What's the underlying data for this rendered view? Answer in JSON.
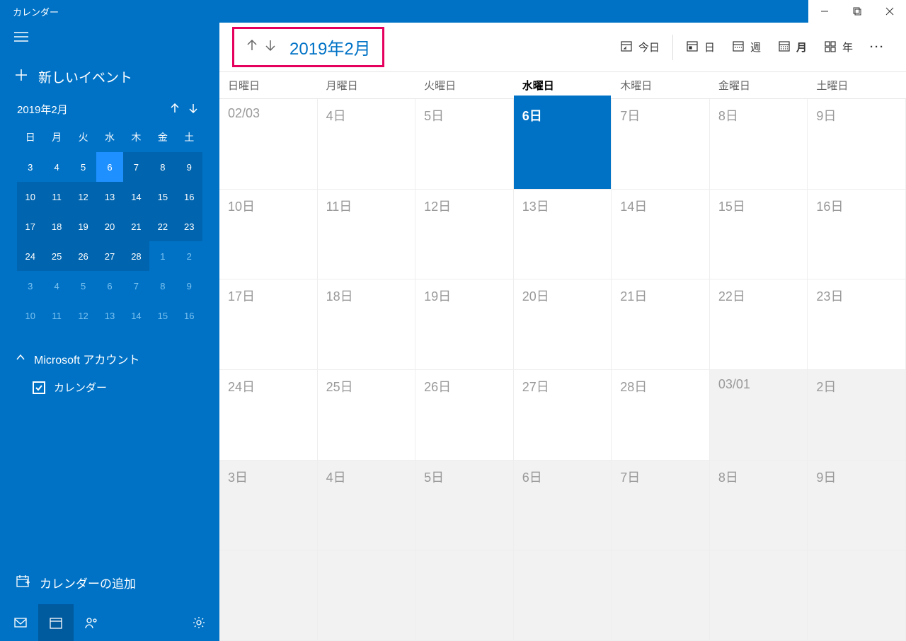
{
  "titlebar": {
    "title": "カレンダー"
  },
  "sidebar": {
    "new_event": "新しいイベント",
    "mini_cal": {
      "title": "2019年2月",
      "dow": [
        "日",
        "月",
        "火",
        "水",
        "木",
        "金",
        "土"
      ],
      "weeks": [
        [
          {
            "d": "3"
          },
          {
            "d": "4"
          },
          {
            "d": "5"
          },
          {
            "d": "6",
            "today": true
          },
          {
            "d": "7",
            "block": true
          },
          {
            "d": "8",
            "block": true
          },
          {
            "d": "9",
            "block": true
          }
        ],
        [
          {
            "d": "10",
            "block": true
          },
          {
            "d": "11",
            "block": true
          },
          {
            "d": "12",
            "block": true
          },
          {
            "d": "13",
            "block": true
          },
          {
            "d": "14",
            "block": true
          },
          {
            "d": "15",
            "block": true
          },
          {
            "d": "16",
            "block": true
          }
        ],
        [
          {
            "d": "17",
            "block": true
          },
          {
            "d": "18",
            "block": true
          },
          {
            "d": "19",
            "block": true
          },
          {
            "d": "20",
            "block": true
          },
          {
            "d": "21",
            "block": true
          },
          {
            "d": "22",
            "block": true
          },
          {
            "d": "23",
            "block": true
          }
        ],
        [
          {
            "d": "24",
            "block": true
          },
          {
            "d": "25",
            "block": true
          },
          {
            "d": "26",
            "block": true
          },
          {
            "d": "27",
            "block": true
          },
          {
            "d": "28",
            "block": true
          },
          {
            "d": "1",
            "nextmonth": true
          },
          {
            "d": "2",
            "nextmonth": true
          }
        ],
        [
          {
            "d": "3",
            "nextmonth": true
          },
          {
            "d": "4",
            "nextmonth": true
          },
          {
            "d": "5",
            "nextmonth": true
          },
          {
            "d": "6",
            "nextmonth": true
          },
          {
            "d": "7",
            "nextmonth": true
          },
          {
            "d": "8",
            "nextmonth": true
          },
          {
            "d": "9",
            "nextmonth": true
          }
        ],
        [
          {
            "d": "10",
            "nextmonth": true
          },
          {
            "d": "11",
            "nextmonth": true
          },
          {
            "d": "12",
            "nextmonth": true
          },
          {
            "d": "13",
            "nextmonth": true
          },
          {
            "d": "14",
            "nextmonth": true
          },
          {
            "d": "15",
            "nextmonth": true
          },
          {
            "d": "16",
            "nextmonth": true
          }
        ]
      ]
    },
    "account_header": "Microsoft アカウント",
    "account_item": "カレンダー",
    "add_calendar": "カレンダーの追加"
  },
  "toolbar": {
    "month_title": "2019年2月",
    "today": "今日",
    "views": {
      "day": "日",
      "week": "週",
      "month": "月",
      "year": "年"
    }
  },
  "dow": [
    {
      "label": "日曜日"
    },
    {
      "label": "月曜日"
    },
    {
      "label": "火曜日"
    },
    {
      "label": "水曜日",
      "today_col": true
    },
    {
      "label": "木曜日"
    },
    {
      "label": "金曜日"
    },
    {
      "label": "土曜日"
    }
  ],
  "grid": [
    [
      {
        "d": "02/03"
      },
      {
        "d": "4日"
      },
      {
        "d": "5日"
      },
      {
        "d": "6日",
        "today": true
      },
      {
        "d": "7日"
      },
      {
        "d": "8日"
      },
      {
        "d": "9日"
      }
    ],
    [
      {
        "d": "10日"
      },
      {
        "d": "11日"
      },
      {
        "d": "12日"
      },
      {
        "d": "13日"
      },
      {
        "d": "14日"
      },
      {
        "d": "15日"
      },
      {
        "d": "16日"
      }
    ],
    [
      {
        "d": "17日"
      },
      {
        "d": "18日"
      },
      {
        "d": "19日"
      },
      {
        "d": "20日"
      },
      {
        "d": "21日"
      },
      {
        "d": "22日"
      },
      {
        "d": "23日"
      }
    ],
    [
      {
        "d": "24日"
      },
      {
        "d": "25日"
      },
      {
        "d": "26日"
      },
      {
        "d": "27日"
      },
      {
        "d": "28日"
      },
      {
        "d": "03/01",
        "othermonth": true
      },
      {
        "d": "2日",
        "othermonth": true
      }
    ],
    [
      {
        "d": "3日",
        "othermonth": true
      },
      {
        "d": "4日",
        "othermonth": true
      },
      {
        "d": "5日",
        "othermonth": true
      },
      {
        "d": "6日",
        "othermonth": true
      },
      {
        "d": "7日",
        "othermonth": true
      },
      {
        "d": "8日",
        "othermonth": true
      },
      {
        "d": "9日",
        "othermonth": true
      }
    ]
  ]
}
